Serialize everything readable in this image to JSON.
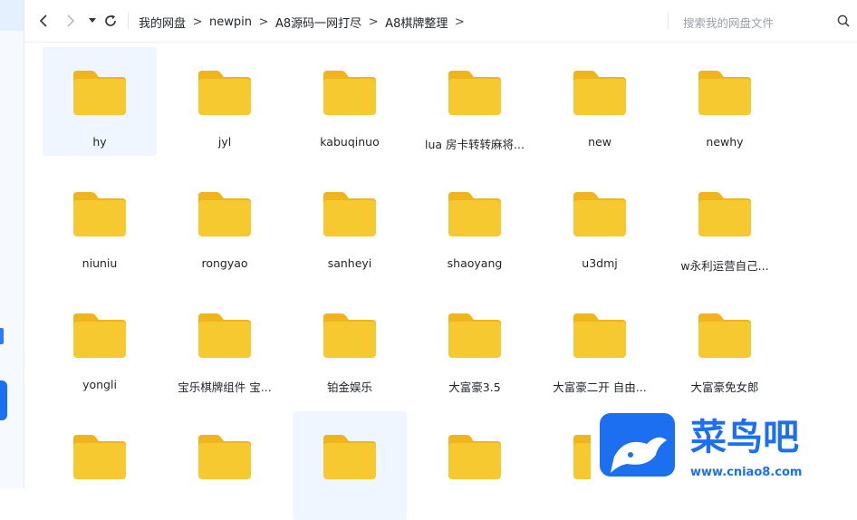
{
  "toolbar": {
    "breadcrumbs": [
      "我的网盘",
      "newpin",
      "A8源码一网打尽",
      "A8棋牌整理"
    ],
    "search_placeholder": "搜索我的网盘文件"
  },
  "folders": [
    {
      "name": "hy",
      "selected": true
    },
    {
      "name": "jyl"
    },
    {
      "name": "kabuqinuo"
    },
    {
      "name": "lua 房卡转转麻将..."
    },
    {
      "name": "new"
    },
    {
      "name": "newhy"
    },
    {
      "name": "niuniu"
    },
    {
      "name": "rongyao"
    },
    {
      "name": "sanheyi"
    },
    {
      "name": "shaoyang"
    },
    {
      "name": "u3dmj"
    },
    {
      "name": "w永利运营自己..."
    },
    {
      "name": "yongli"
    },
    {
      "name": "宝乐棋牌组件 宝..."
    },
    {
      "name": "铂金娱乐"
    },
    {
      "name": "大富豪3.5"
    },
    {
      "name": "大富豪二开 自由..."
    },
    {
      "name": "大富豪免女郎"
    },
    {
      "name": ""
    },
    {
      "name": ""
    },
    {
      "name": "",
      "selected": true
    },
    {
      "name": ""
    },
    {
      "name": ""
    }
  ],
  "watermark": {
    "brand": "菜鸟吧",
    "url": "www.cniao8.com"
  },
  "colors": {
    "folder": "#f7c930",
    "folder_tab": "#f0b51c",
    "accent": "#1d6ff2",
    "selection": "#f0f6ff"
  }
}
